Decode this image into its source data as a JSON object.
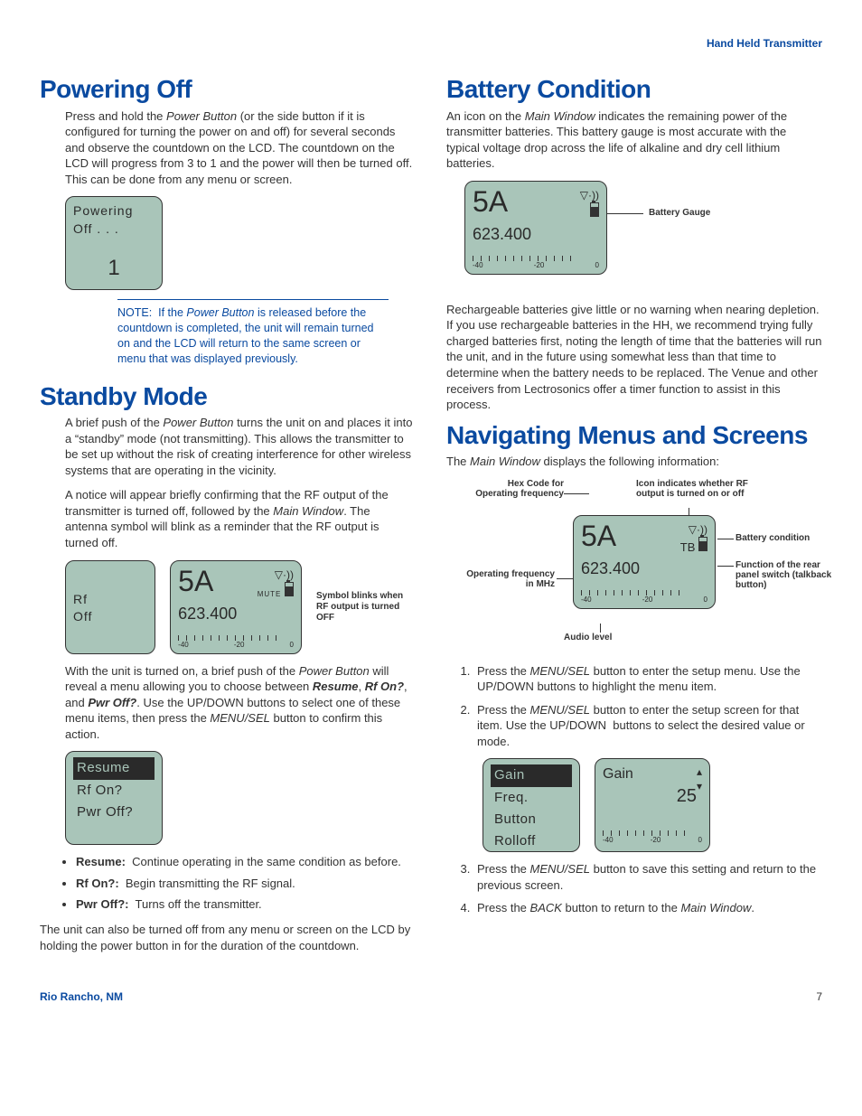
{
  "runningHead": "Hand Held Transmitter",
  "footer": {
    "location": "Rio Rancho, NM",
    "page": "7"
  },
  "powerOff": {
    "heading": "Powering Off",
    "body": "Press and hold the Power Button (or the side button if it is configured for turning the power on and off) for several seconds and observe the countdown on the LCD. The countdown on the LCD will progress from 3 to 1 and the power will then be turned off. This can be done from any menu or screen.",
    "lcd": {
      "line1": "Powering",
      "line2": "Off . . .",
      "count": "1"
    },
    "note": "NOTE:  If the Power Button is released before the countdown is completed, the unit will remain turned on and the LCD will return to the same screen or menu that was displayed previously."
  },
  "standby": {
    "heading": "Standby Mode",
    "p1": "A brief push of the Power Button turns the unit on and places it into a \"standby\" mode (not transmitting). This allows the transmitter to be set up without the risk of creating interference for other wireless systems that are operating in the vicinity.",
    "p2": "A notice will appear briefly confirming that the RF output of the transmitter is turned off, followed by the Main Window. The antenna symbol will blink as a reminder that the RF output is turned off.",
    "lcdLeft": {
      "l1": "Rf",
      "l2": "Off"
    },
    "lcdRight": {
      "hex": "5A",
      "mute": "MUTE",
      "freq": "623.400",
      "m1": "-40",
      "m2": "-20",
      "m3": "0"
    },
    "blinkLabel": "Symbol blinks when RF output is turned OFF",
    "p3": "With the unit is turned on, a brief push of the Power Button will reveal a menu allowing you to choose between Resume, Rf On?, and Pwr Off?. Use the UP/DOWN buttons to select one of these menu items, then press the MENU/SEL button to confirm this action.",
    "menu": {
      "i1": "Resume",
      "i2": "Rf On?",
      "i3": "Pwr Off?"
    },
    "bullets": {
      "b1": "Continue operating in the same condition as before.",
      "b2": "Begin transmitting the RF signal.",
      "b3": "Turns off the transmitter."
    },
    "p4": "The unit can also be turned off from any menu or screen on the LCD by holding the power button in for the duration of the countdown."
  },
  "battery": {
    "heading": "Battery Condition",
    "p1": "An icon on the Main Window indicates the remaining power of the transmitter batteries. This battery gauge is most accurate with the typical voltage drop across the life of alkaline and dry cell lithium batteries.",
    "lcd": {
      "hex": "5A",
      "freq": "623.400",
      "m1": "-40",
      "m2": "-20",
      "m3": "0"
    },
    "gaugeLabel": "Battery Gauge",
    "p2": "Rechargeable batteries give little or no warning when nearing depletion. If you use rechargeable batteries in the HH, we recommend trying fully charged batteries first, noting the length of time that the batteries will run the unit, and in the future using somewhat less than that time to determine when the battery needs to be replaced. The Venue and other receivers from Lectrosonics offer a timer function to assist in this process."
  },
  "nav": {
    "heading": "Navigating Menus and Screens",
    "p1": "The Main Window displays the following information:",
    "callouts": {
      "hex": "Hex Code for Operating frequency",
      "rf": "Icon indicates whether RF output is turned on or off",
      "batt": "Battery condition",
      "func": "Function of the rear panel switch (talkback button)",
      "freq": "Operating frequency in MHz",
      "audio": "Audio level"
    },
    "lcd": {
      "hex": "5A",
      "tb": "TB",
      "freq": "623.400",
      "m1": "-40",
      "m2": "-20",
      "m3": "0"
    },
    "steps": {
      "s1": "Press the MENU/SEL button to enter the setup menu. Use the UP/DOWN buttons to highlight the menu item.",
      "s2": "Press the MENU/SEL button to enter the setup screen for that item. Use the UP/DOWN  buttons to select the desired value or mode.",
      "s3": "Press the MENU/SEL button to save this setting and return to the previous screen.",
      "s4": "Press the BACK button to return to the Main Window."
    },
    "menuLcd": {
      "i1": "Gain",
      "i2": "Freq.",
      "i3": "Button",
      "i4": "Rolloff"
    },
    "gainLcd": {
      "title": "Gain",
      "value": "25",
      "m1": "-40",
      "m2": "-20",
      "m3": "0"
    }
  }
}
